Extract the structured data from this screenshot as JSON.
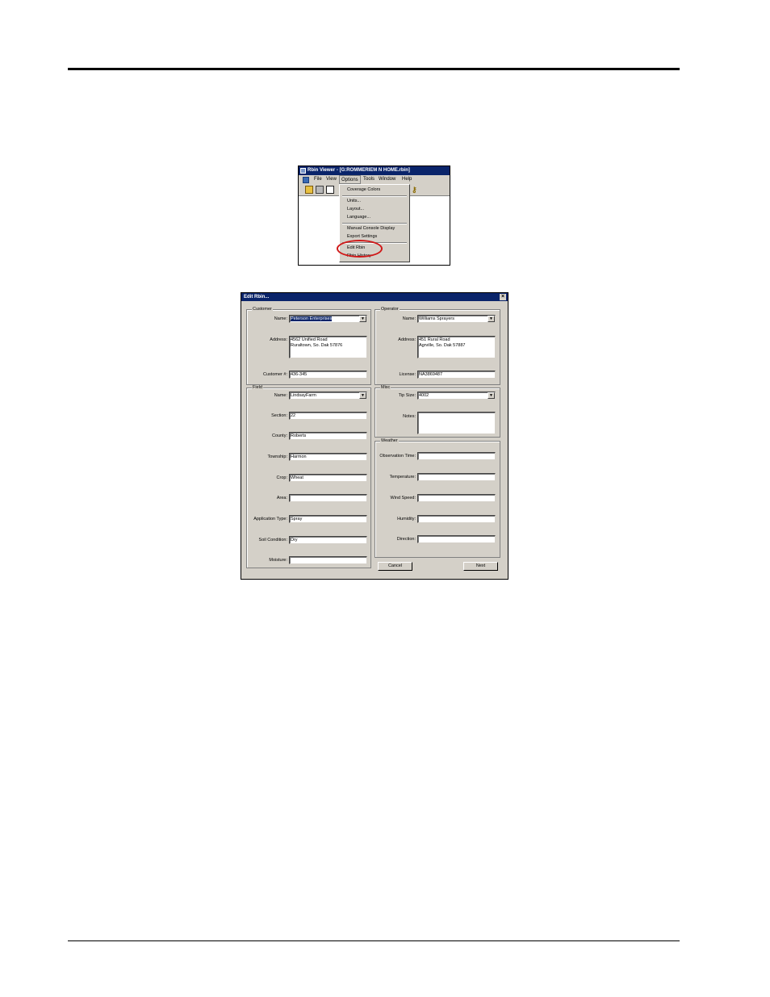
{
  "menu_screenshot": {
    "title": "Rbin Viewer - [G:ROMMERIEM N HOME.rbin]",
    "menubar": [
      "File",
      "View",
      "Options",
      "Tools",
      "Window",
      "Help"
    ],
    "options_menu": [
      "Coverage Colors",
      "Units...",
      "Layout...",
      "Language...",
      "Manual Console Display",
      "Export Settings",
      "Edit Rbin",
      "Rbin History"
    ],
    "highlight_color": "#d01818"
  },
  "dialog": {
    "title": "Edit Rbin...",
    "close_glyph": "×",
    "customer": {
      "group_label": "Customer",
      "name_label": "Name:",
      "name_value": "Peterson Enterprises",
      "address_label": "Address:",
      "address_value": "4562 Unified Road\nRuraltown, So. Dak 57876",
      "id_label": "Customer #:",
      "id_value": "436-345"
    },
    "operator": {
      "group_label": "Operator",
      "name_label": "Name:",
      "name_value": "Williams Sprayers",
      "address_label": "Address:",
      "address_value": "451 Rural Road\nAgrville, So. Dak 57887",
      "license_label": "License:",
      "license_value": "NA3869487"
    },
    "field": {
      "group_label": "Field",
      "name_label": "Name:",
      "name_value": "LindsayFarm",
      "section_label": "Section:",
      "section_value": "22",
      "county_label": "County:",
      "county_value": "Roberts",
      "township_label": "Township:",
      "township_value": "Harmon",
      "crop_label": "Crop:",
      "crop_value": "Wheat",
      "area_label": "Area:",
      "area_value": "",
      "app_type_label": "Application Type:",
      "app_type_value": "Spray",
      "soil_label": "Soil Condition:",
      "soil_value": "Dry",
      "moisture_label": "Moisture:",
      "moisture_value": ""
    },
    "misc": {
      "group_label": "Misc",
      "tip_label": "Tip Size:",
      "tip_value": "4002",
      "notes_label": "Notes:",
      "notes_value": ""
    },
    "weather": {
      "group_label": "Weather",
      "obs_label": "Observation Time:",
      "obs_value": "",
      "temp_label": "Temperature:",
      "temp_value": "",
      "wind_label": "Wind Speed:",
      "wind_value": "",
      "humidity_label": "Humidity:",
      "humidity_value": "",
      "direction_label": "Direction:",
      "direction_value": ""
    },
    "buttons": {
      "cancel": "Cancel",
      "next": "Next"
    }
  }
}
